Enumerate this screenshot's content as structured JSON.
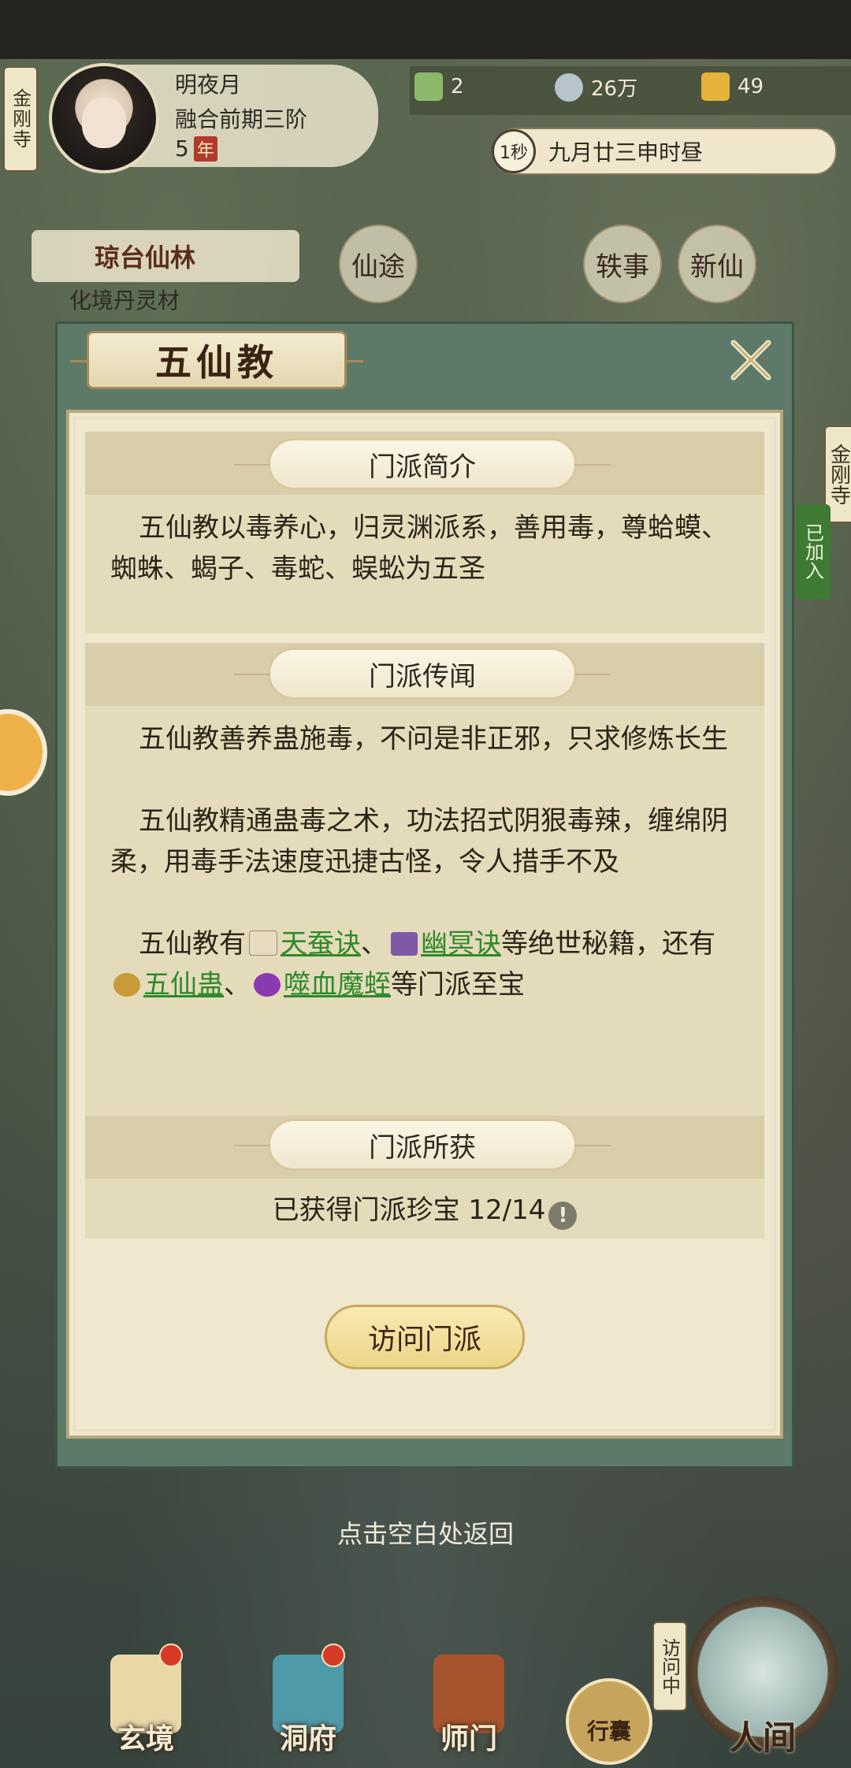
{
  "player": {
    "name": "明夜月",
    "realm": "融合前期三阶",
    "years": "5",
    "year_badge": "年",
    "location_tag": "金刚寺"
  },
  "resources": {
    "spirit_stone": "2",
    "coins": "26万",
    "power": "49"
  },
  "time": {
    "speed": "1秒",
    "date": "九月廿三申时昼"
  },
  "map": {
    "area_name": "琼台仙林",
    "area_sub": "化境丹灵材",
    "badge_1": "仙途",
    "badge_2": "轶事",
    "badge_3": "新仙",
    "right_tag": "金刚寺",
    "right_join": "已加入"
  },
  "dialog": {
    "title": "五仙教",
    "intro_header": "门派简介",
    "intro_text": "五仙教以毒养心，归灵渊派系，善用毒，尊蛤蟆、蜘蛛、蝎子、毒蛇、蜈蚣为五圣",
    "lore_header": "门派传闻",
    "lore_1": "五仙教善养蛊施毒，不问是非正邪，只求修炼长生",
    "lore_2": "五仙教精通蛊毒之术，功法招式阴狠毒辣，缠绵阴柔，用毒手法速度迅捷古怪，令人措手不及",
    "lore_3_prefix": "五仙教有",
    "lore_3_link1": "天蚕诀",
    "lore_3_sep1": "、",
    "lore_3_link2": "幽冥诀",
    "lore_3_mid": "等绝世秘籍，还有",
    "lore_3_link3": "五仙蛊",
    "lore_3_sep2": "、",
    "lore_3_link4": "噬血魔蛭",
    "lore_3_suffix": "等门派至宝",
    "owned_header": "门派所获",
    "owned_text": "已获得门派珍宝 12/14",
    "visit_button": "访问门派",
    "dismiss_hint": "点击空白处返回"
  },
  "nav": {
    "items": [
      "玄境",
      "洞府",
      "师门"
    ],
    "bag": "行囊",
    "world": "人间",
    "visiting": "访问中"
  },
  "colors": {
    "link": "#2f8a2a",
    "panel_border": "#5d7a68",
    "button": "#ecd587"
  }
}
